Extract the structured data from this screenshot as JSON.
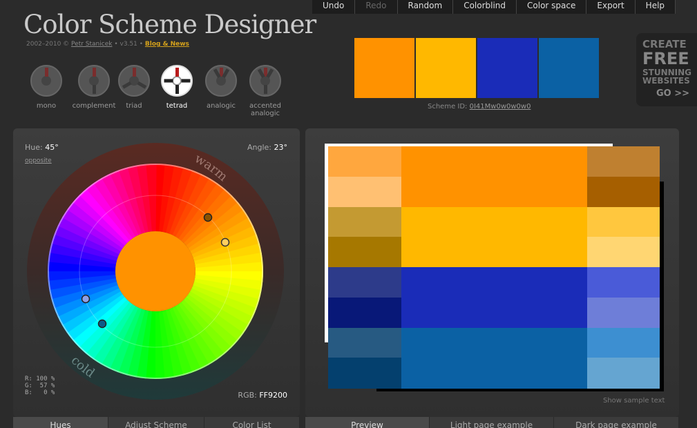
{
  "app": {
    "title": "Color Scheme Designer",
    "copyright": "2002–2010 ©",
    "author": "Petr Stanicek",
    "version": "• v3.51 •",
    "blog": "Blog & News"
  },
  "modes": [
    {
      "label": "mono",
      "active": false,
      "icon": "mono-wheel-icon"
    },
    {
      "label": "complement",
      "active": false,
      "icon": "complement-wheel-icon"
    },
    {
      "label": "triad",
      "active": false,
      "icon": "triad-wheel-icon"
    },
    {
      "label": "tetrad",
      "active": true,
      "icon": "tetrad-wheel-icon"
    },
    {
      "label": "analogic",
      "active": false,
      "icon": "analogic-wheel-icon"
    },
    {
      "label": "accented analogic",
      "active": false,
      "icon": "accented-analogic-wheel-icon"
    }
  ],
  "menu": [
    "Undo",
    "Redo",
    "Random",
    "Colorblind",
    "Color space",
    "Export",
    "Help"
  ],
  "menu_disabled": [
    "Redo"
  ],
  "swatches": [
    "#FF9200",
    "#FFB800",
    "#1A2CB8",
    "#0B61A4"
  ],
  "scheme": {
    "label": "Scheme ID:",
    "id": "0I41Mw0w0w0w0"
  },
  "ad": {
    "l1": "CREATE",
    "l2": "FREE",
    "l3": "STUNNING",
    "l4": "WEBSITES",
    "l5": "GO >>"
  },
  "wheel": {
    "hue_label": "Hue:",
    "hue": "45°",
    "angle_label": "Angle:",
    "angle": "23°",
    "opposite": "opposite",
    "warm": "warm",
    "cold": "cold",
    "rgb_pct": "R: 100 %\nG:  57 %\nB:   0 %",
    "rgb_label": "RGB:",
    "rgb": "FF9200",
    "center_color": "#FF9200"
  },
  "preview": {
    "show_sample": "Show sample text",
    "rows": [
      [
        "#FFA73E",
        "#FF9200",
        "#BF8030"
      ],
      [
        "#FFC072",
        "#FF9200",
        "#A65F00"
      ],
      [
        "#C49A32",
        "#FFB800",
        "#FFC73E"
      ],
      [
        "#A67800",
        "#FFB800",
        "#FFD672"
      ],
      [
        "#2D3B8A",
        "#1A2CB8",
        "#4A5BD8"
      ],
      [
        "#081878",
        "#1A2CB8",
        "#6E7ED8"
      ],
      [
        "#275A82",
        "#0B61A4",
        "#3D8FD1"
      ],
      [
        "#04406E",
        "#0B61A4",
        "#65A5D1"
      ]
    ]
  },
  "tabs_left": [
    "Hues",
    "Adjust Scheme",
    "Color List"
  ],
  "tabs_right": [
    "Preview",
    "Light page example",
    "Dark page example"
  ]
}
